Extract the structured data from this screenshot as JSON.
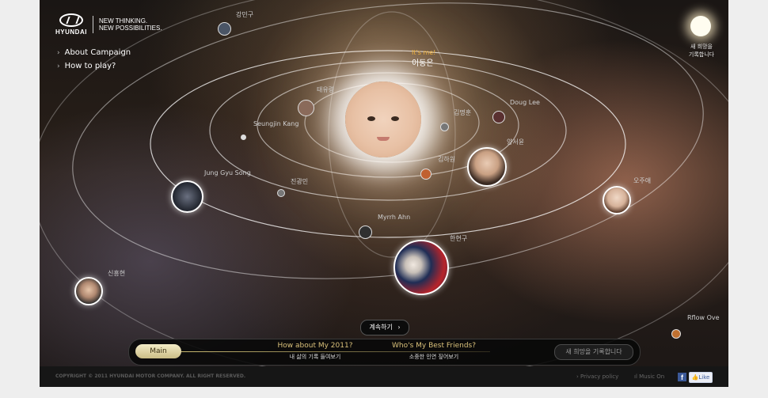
{
  "brand": {
    "wordmark": "HYUNDAI",
    "tagline_line1": "NEW THINKING.",
    "tagline_line2": "NEW POSSIBILITIES."
  },
  "side_menu": {
    "about": "About Campaign",
    "how_to_play": "How to play?"
  },
  "me": {
    "tag": "It's me!",
    "name": "이동은"
  },
  "friends": {
    "kang_mingu": "강민구",
    "taeyoung": "태유령",
    "kim_myeongho": "김명훈",
    "doug_lee": "Doug Lee",
    "yang_seoyoon": "양서윤",
    "seungjin_kang": "Seungjin Kang",
    "kim_jisu": "김하원",
    "jin_gwangmin": "진광민",
    "jung_gyu_song": "Jung Gyu Song",
    "oh_jueun": "오주애",
    "myrrh_ahn": "Myrrh Ahn",
    "han_hyeongu": "한현구",
    "shin_heunghyun": "신흥현",
    "rflow_ove": "Rflow Ove"
  },
  "new_hope": {
    "label_line1": "새 희망을",
    "label_line2": "기록합니다"
  },
  "continue_button": "계속하기",
  "nav": {
    "main": "Main",
    "tab1_title": "How about My 2011?",
    "tab1_sub": "내 삶의 기록 들여보기",
    "tab2_title": "Who's My Best Friends?",
    "tab2_sub": "소중한 인연 짚어보기",
    "record": "새 희망을 기록합니다"
  },
  "footer": {
    "copyright": "COPYRIGHT © 2011 HYUNDAI MOTOR COMPANY.  ALL RIGHT RESERVED.",
    "privacy": "Privacy policy",
    "music": "Music On",
    "like": "Like"
  },
  "colors": {
    "accent_gold": "#d9c07a",
    "facebook_blue": "#3b5998"
  }
}
